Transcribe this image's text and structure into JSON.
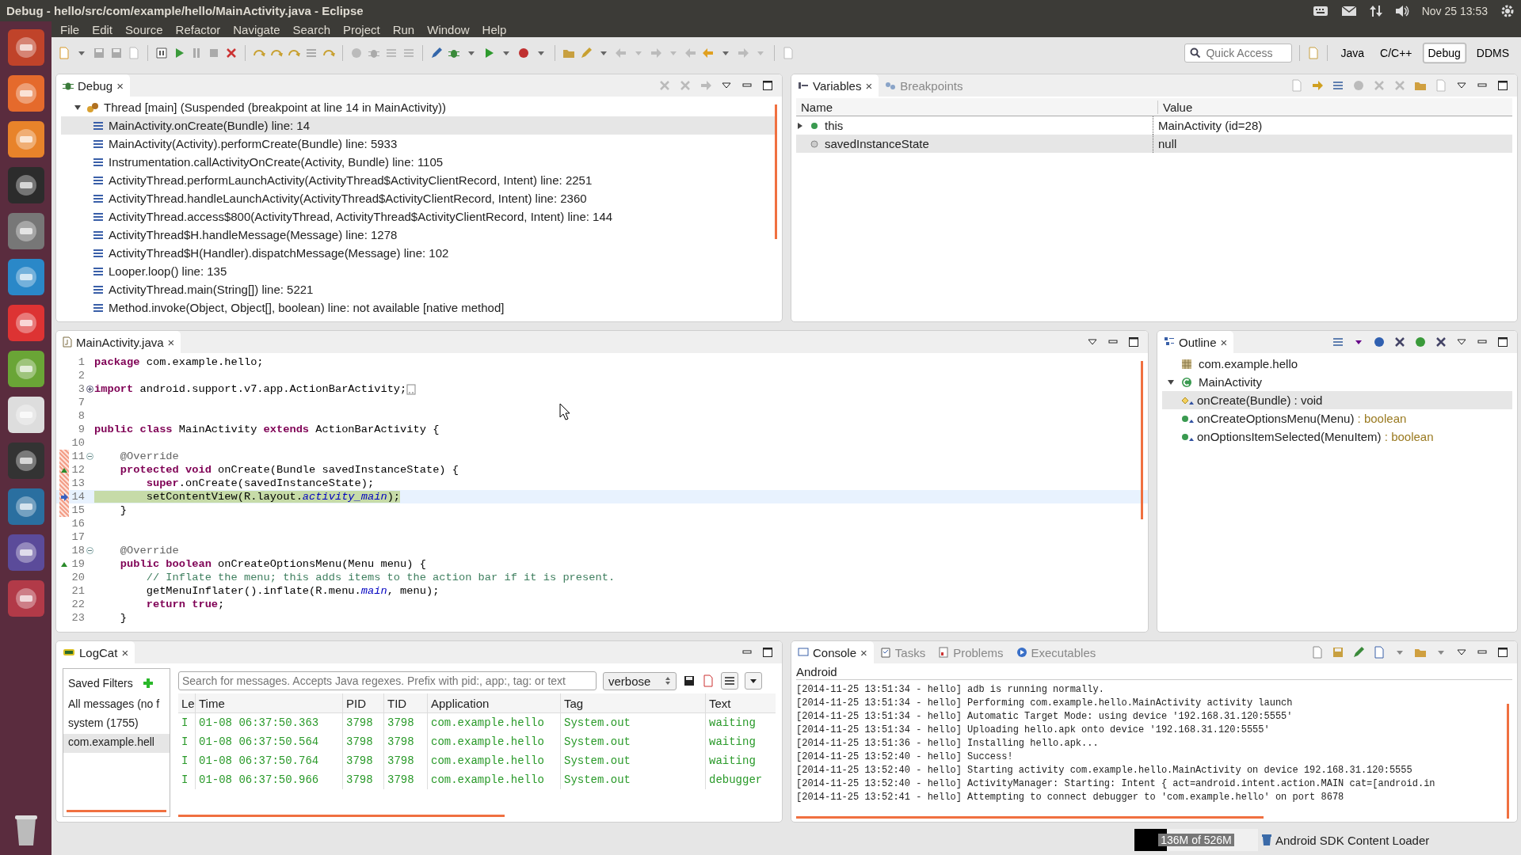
{
  "top_bar": {
    "title": "Debug - hello/src/com/example/hello/MainActivity.java - Eclipse",
    "clock": "Nov 25 13:53"
  },
  "menu": [
    "File",
    "Edit",
    "Source",
    "Refactor",
    "Navigate",
    "Search",
    "Project",
    "Run",
    "Window",
    "Help"
  ],
  "quick_access": {
    "placeholder": "Quick Access"
  },
  "perspectives": [
    {
      "label": "Java",
      "selected": false
    },
    {
      "label": "C/C++",
      "selected": false
    },
    {
      "label": "Debug",
      "selected": true
    },
    {
      "label": "DDMS",
      "selected": false
    }
  ],
  "debug_view": {
    "tab": "Debug",
    "close": "×",
    "thread": {
      "label": "Thread [main] (Suspended (breakpoint at line 14 in MainActivity))",
      "expanded": true,
      "children": [
        {
          "label": "MainActivity.onCreate(Bundle) line: 14",
          "selected": true
        },
        {
          "label": "MainActivity(Activity).performCreate(Bundle) line: 5933",
          "selected": false
        },
        {
          "label": "Instrumentation.callActivityOnCreate(Activity, Bundle) line: 1105",
          "selected": false
        },
        {
          "label": "ActivityThread.performLaunchActivity(ActivityThread$ActivityClientRecord, Intent) line: 2251",
          "selected": false
        },
        {
          "label": "ActivityThread.handleLaunchActivity(ActivityThread$ActivityClientRecord, Intent) line: 2360",
          "selected": false
        },
        {
          "label": "ActivityThread.access$800(ActivityThread, ActivityThread$ActivityClientRecord, Intent) line: 144",
          "selected": false
        },
        {
          "label": "ActivityThread$H.handleMessage(Message) line: 1278",
          "selected": false
        },
        {
          "label": "ActivityThread$H(Handler).dispatchMessage(Message) line: 102",
          "selected": false
        },
        {
          "label": "Looper.loop() line: 135",
          "selected": false
        },
        {
          "label": "ActivityThread.main(String[]) line: 5221",
          "selected": false
        },
        {
          "label": "Method.invoke(Object, Object[], boolean) line: not available [native method]",
          "selected": false
        }
      ]
    }
  },
  "variables_view": {
    "tabs": [
      {
        "label": "Variables",
        "close": "×",
        "selected": true
      },
      {
        "label": "Breakpoints",
        "selected": false
      }
    ],
    "columns": [
      "Name",
      "Value"
    ],
    "rows": [
      {
        "name": "this",
        "value": "MainActivity (id=28)",
        "kind": "object",
        "expandable": true,
        "selected": false
      },
      {
        "name": "savedInstanceState",
        "value": "null",
        "kind": "local",
        "expandable": false,
        "selected": true
      }
    ]
  },
  "editor": {
    "tab": "MainActivity.java",
    "close": "×",
    "lines": [
      {
        "n": "1",
        "code": [
          {
            "kind": "kw",
            "t": "package "
          },
          {
            "kind": "txt",
            "t": "com.example.hello;"
          }
        ],
        "marked": false,
        "current": false
      },
      {
        "n": "2",
        "marked": false,
        "current": false
      },
      {
        "n": "3",
        "collapsed": true,
        "code": [
          {
            "kind": "kw",
            "t": "import "
          },
          {
            "kind": "txt",
            "t": "android.support.v7.app.ActionBarActivity;"
          }
        ],
        "marked": false,
        "current": false
      },
      {
        "n": "7",
        "marked": false,
        "current": false
      },
      {
        "n": "8",
        "marked": false,
        "current": false
      },
      {
        "n": "9",
        "code": [
          {
            "kind": "kw",
            "t": "public "
          },
          {
            "kind": "kw",
            "t": "class "
          },
          {
            "kind": "txt",
            "t": "MainActivity "
          },
          {
            "kind": "kw",
            "t": "extends "
          },
          {
            "kind": "txt",
            "t": "ActionBarActivity {"
          }
        ],
        "marked": false,
        "current": false
      },
      {
        "n": "10",
        "marked": false,
        "current": false
      },
      {
        "n": "11",
        "collapsed": false,
        "code": [
          {
            "kind": "ann",
            "t": "    @Override"
          }
        ],
        "marked": true,
        "current": false
      },
      {
        "n": "12",
        "annotation": {
          "kind": "override"
        },
        "code": [
          {
            "kind": "kw",
            "t": "    protected "
          },
          {
            "kind": "kw",
            "t": "void "
          },
          {
            "kind": "txt",
            "t": "onCreate(Bundle savedInstanceState) {"
          }
        ],
        "marked": true,
        "current": false
      },
      {
        "n": "13",
        "code": [
          {
            "kind": "kw",
            "t": "        super"
          },
          {
            "kind": "txt",
            "t": ".onCreate(savedInstanceState);"
          }
        ],
        "marked": true,
        "current": false
      },
      {
        "n": "14",
        "annotation": {
          "kind": "instruction"
        },
        "code": [
          {
            "kind": "txt",
            "t": "        setContentView(R.layout."
          },
          {
            "kind": "fld",
            "t": "activity_main"
          },
          {
            "kind": "txt",
            "t": ");"
          }
        ],
        "marked": true,
        "current": true
      },
      {
        "n": "15",
        "code": [
          {
            "kind": "txt",
            "t": "    }"
          }
        ],
        "marked": true,
        "current": false
      },
      {
        "n": "16",
        "marked": false,
        "current": false
      },
      {
        "n": "17",
        "marked": false,
        "current": false
      },
      {
        "n": "18",
        "collapsed": false,
        "code": [
          {
            "kind": "ann",
            "t": "    @Override"
          }
        ],
        "marked": false,
        "current": false
      },
      {
        "n": "19",
        "annotation": {
          "kind": "override"
        },
        "code": [
          {
            "kind": "kw",
            "t": "    public "
          },
          {
            "kind": "kw",
            "t": "boolean "
          },
          {
            "kind": "txt",
            "t": "onCreateOptionsMenu(Menu menu) {"
          }
        ],
        "marked": false,
        "current": false
      },
      {
        "n": "20",
        "code": [
          {
            "kind": "com",
            "t": "        // Inflate the menu; this adds items to the action bar if it is present."
          }
        ],
        "marked": false,
        "current": false
      },
      {
        "n": "21",
        "code": [
          {
            "kind": "txt",
            "t": "        getMenuInflater().inflate(R.menu."
          },
          {
            "kind": "fld",
            "t": "main"
          },
          {
            "kind": "txt",
            "t": ", menu);"
          }
        ],
        "marked": false,
        "current": false
      },
      {
        "n": "22",
        "code": [
          {
            "kind": "kw",
            "t": "        return "
          },
          {
            "kind": "kw",
            "t": "true"
          },
          {
            "kind": "txt",
            "t": ";"
          }
        ],
        "marked": false,
        "current": false
      },
      {
        "n": "23",
        "code": [
          {
            "kind": "txt",
            "t": "    }"
          }
        ],
        "marked": false,
        "current": false
      }
    ]
  },
  "outline": {
    "tab": "Outline",
    "close": "×",
    "items": [
      {
        "label": "com.example.hello",
        "kind": "package",
        "selected": false
      },
      {
        "label": "MainActivity",
        "kind": "class",
        "selected": false,
        "expanded": true,
        "children": [
          {
            "label": "onCreate(Bundle)",
            "type": " : void",
            "kind": "protected_method",
            "selected": true
          },
          {
            "label": "onCreateOptionsMenu(Menu)",
            "type": " : boolean",
            "kind": "public_method",
            "selected": false
          },
          {
            "label": "onOptionsItemSelected(MenuItem)",
            "type": " : boolean",
            "kind": "public_method",
            "selected": false
          }
        ]
      }
    ]
  },
  "logcat": {
    "tab": "LogCat",
    "close": "×",
    "filters_title": "Saved Filters",
    "filters": [
      {
        "label": "All messages (no f",
        "selected": false
      },
      {
        "label": "system (1755)",
        "selected": false
      },
      {
        "label": "com.example.hell",
        "selected": true
      }
    ],
    "search": {
      "placeholder": "Search for messages. Accepts Java regexes. Prefix with pid:, app:, tag: or text"
    },
    "level_select": "verbose",
    "columns": [
      "Le",
      "Time",
      "PID",
      "TID",
      "Application",
      "Tag",
      "Text"
    ],
    "rows": [
      [
        "I",
        "01-08 06:37:50.363",
        "3798",
        "3798",
        "com.example.hello",
        "System.out",
        "waiting"
      ],
      [
        "I",
        "01-08 06:37:50.564",
        "3798",
        "3798",
        "com.example.hello",
        "System.out",
        "waiting"
      ],
      [
        "I",
        "01-08 06:37:50.764",
        "3798",
        "3798",
        "com.example.hello",
        "System.out",
        "waiting"
      ],
      [
        "I",
        "01-08 06:37:50.966",
        "3798",
        "3798",
        "com.example.hello",
        "System.out",
        "debugger"
      ]
    ]
  },
  "console": {
    "tabs": [
      {
        "label": "Console",
        "close": "×",
        "selected": true
      },
      {
        "label": "Tasks",
        "selected": false
      },
      {
        "label": "Problems",
        "selected": false
      },
      {
        "label": "Executables",
        "selected": false
      }
    ],
    "title": "Android",
    "lines": [
      "[2014-11-25 13:51:34 - hello] adb is running normally.",
      "[2014-11-25 13:51:34 - hello] Performing com.example.hello.MainActivity activity launch",
      "[2014-11-25 13:51:34 - hello] Automatic Target Mode: using device '192.168.31.120:5555'",
      "[2014-11-25 13:51:34 - hello] Uploading hello.apk onto device '192.168.31.120:5555'",
      "[2014-11-25 13:51:36 - hello] Installing hello.apk...",
      "[2014-11-25 13:52:40 - hello] Success!",
      "[2014-11-25 13:52:40 - hello] Starting activity com.example.hello.MainActivity on device 192.168.31.120:5555",
      "[2014-11-25 13:52:40 - hello] ActivityManager: Starting: Intent { act=android.intent.action.MAIN cat=[android.in",
      "[2014-11-25 13:52:41 - hello] Attempting to connect debugger to 'com.example.hello' on port 8678"
    ]
  },
  "status_bar": {
    "memory": {
      "label": "136M of 526M",
      "level": 0.26
    },
    "job": "Android SDK Content Loader"
  }
}
